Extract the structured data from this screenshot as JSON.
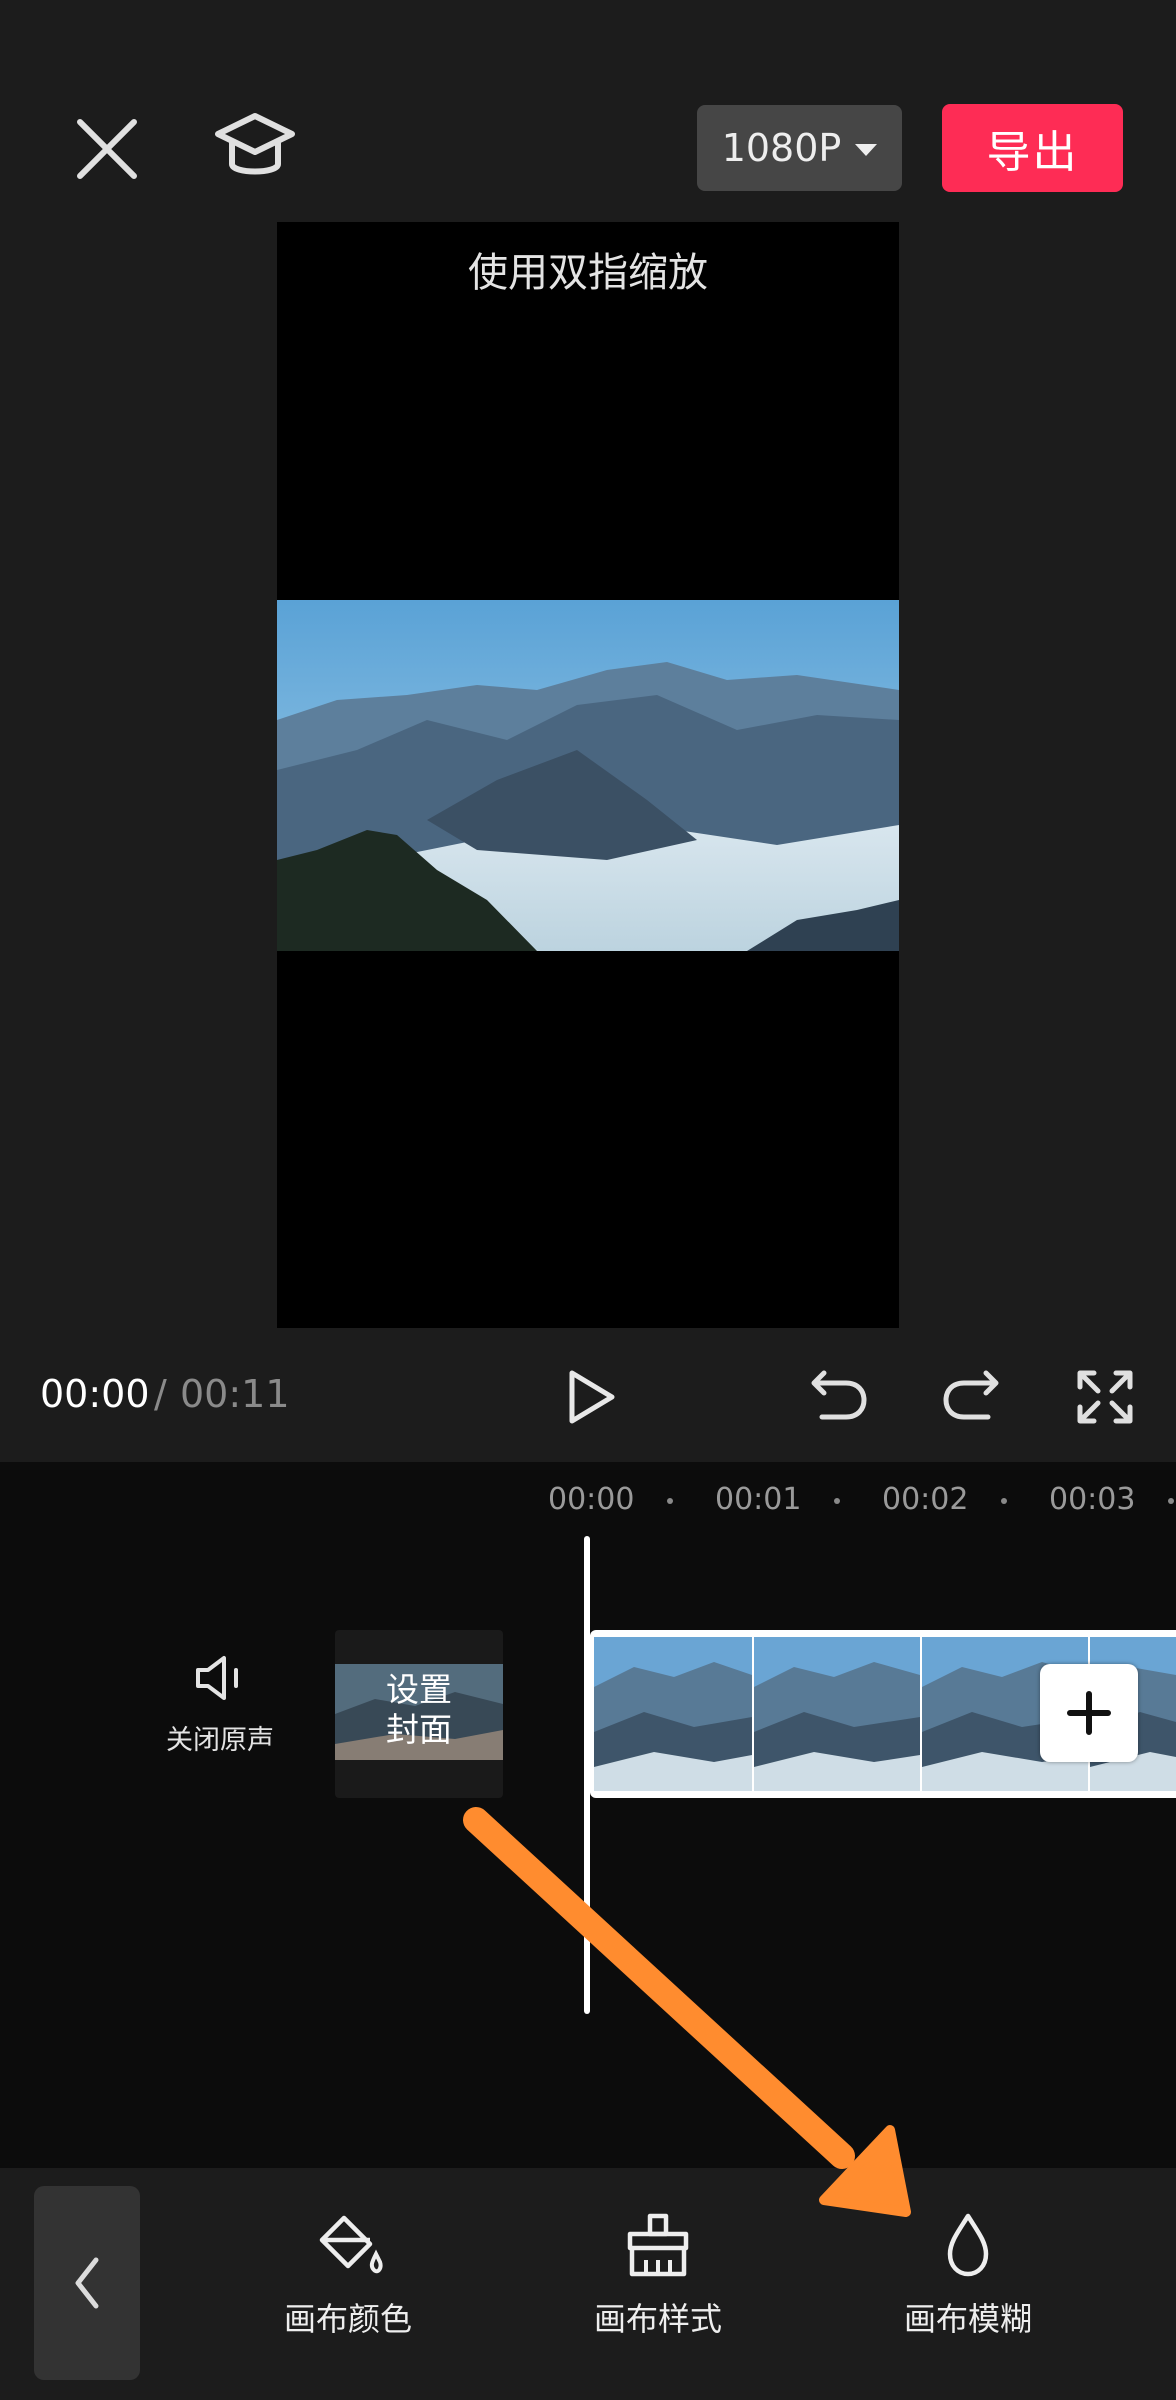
{
  "header": {
    "resolution_label": "1080P",
    "export_label": "导出"
  },
  "preview": {
    "hint": "使用双指缩放"
  },
  "playback": {
    "current_time": "00:00",
    "separator": "/",
    "total_time": "00:11"
  },
  "timeline": {
    "ticks": [
      "00:00",
      "00:01",
      "00:02",
      "00:03"
    ],
    "mute_label": "关闭原声",
    "cover_label_line1": "设置",
    "cover_label_line2": "封面"
  },
  "toolbar": {
    "items": [
      {
        "label": "画布颜色",
        "icon": "paint-bucket-icon"
      },
      {
        "label": "画布样式",
        "icon": "brush-icon"
      },
      {
        "label": "画布模糊",
        "icon": "droplet-icon"
      }
    ]
  },
  "colors": {
    "export": "#fe2c55",
    "annotation_arrow": "#ff8c2f",
    "background": "#1c1c1c"
  }
}
